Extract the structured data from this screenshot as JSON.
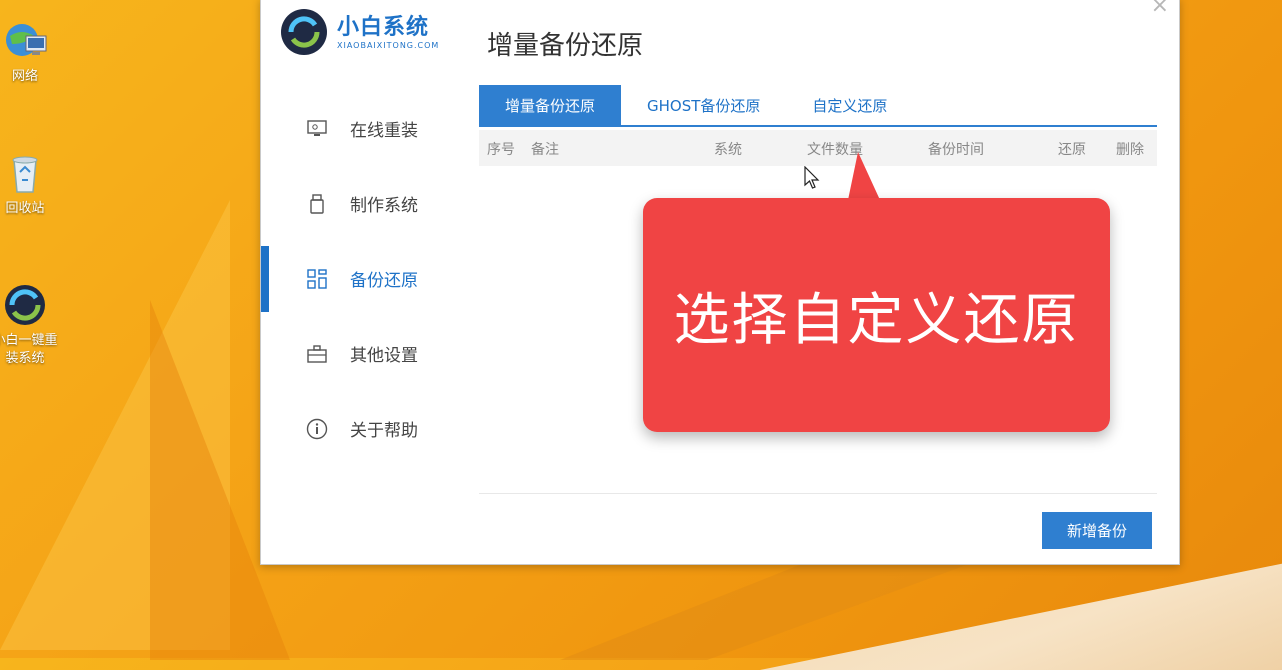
{
  "desktop": {
    "icons": [
      {
        "label": "网络"
      },
      {
        "label": "回收站"
      },
      {
        "label": "小白一键重装系统"
      }
    ]
  },
  "app": {
    "brand": "小白系统",
    "brand_sub": "XIAOBAIXITONG.COM",
    "nav": [
      {
        "label": "在线重装",
        "icon": "monitor-icon"
      },
      {
        "label": "制作系统",
        "icon": "usb-icon"
      },
      {
        "label": "备份还原",
        "icon": "grid-icon",
        "active": true
      },
      {
        "label": "其他设置",
        "icon": "briefcase-icon"
      },
      {
        "label": "关于帮助",
        "icon": "info-icon"
      }
    ],
    "page_title": "增量备份还原",
    "tabs": [
      {
        "label": "增量备份还原",
        "active": true
      },
      {
        "label": "GHOST备份还原"
      },
      {
        "label": "自定义还原"
      }
    ],
    "table_columns": [
      "序号",
      "备注",
      "系统",
      "文件数量",
      "备份时间",
      "还原",
      "删除"
    ],
    "add_button": "新增备份"
  },
  "callout": {
    "text": "选择自定义还原"
  },
  "colors": {
    "accent": "#2f7fd0",
    "callout": "#f04444",
    "desktop": "#f5a417"
  }
}
